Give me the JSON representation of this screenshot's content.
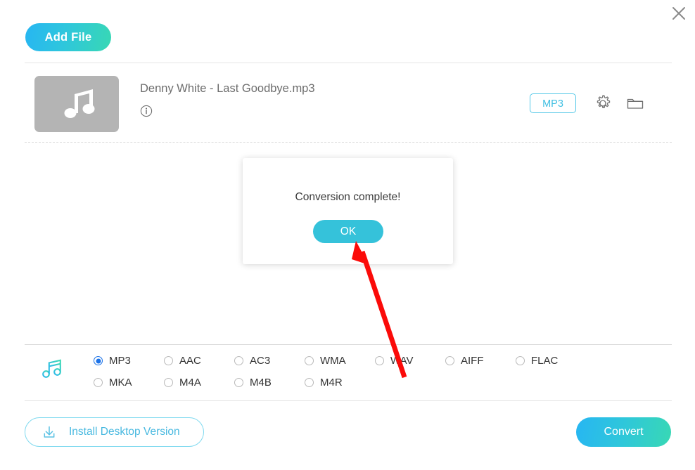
{
  "window": {
    "close_label": "×",
    "close_icon": "close-icon"
  },
  "toolbar": {
    "add_file_label": "Add File"
  },
  "file_row": {
    "thumbnail_icon": "music-note-icon",
    "file_name": "Denny White - Last Goodbye.mp3",
    "info_icon": "info-icon",
    "output_format_chip": "MP3",
    "settings_icon": "gear-icon",
    "folder_icon": "folder-icon"
  },
  "format_panel": {
    "panel_icon": "music-note-icon",
    "selected_format": "MP3",
    "row1": [
      {
        "label": "MP3",
        "selected": true
      },
      {
        "label": "AAC",
        "selected": false
      },
      {
        "label": "AC3",
        "selected": false
      },
      {
        "label": "WMA",
        "selected": false
      },
      {
        "label": "WAV",
        "selected": false
      },
      {
        "label": "AIFF",
        "selected": false
      },
      {
        "label": "FLAC",
        "selected": false
      }
    ],
    "row2": [
      {
        "label": "MKA",
        "selected": false
      },
      {
        "label": "M4A",
        "selected": false
      },
      {
        "label": "M4B",
        "selected": false
      },
      {
        "label": "M4R",
        "selected": false
      }
    ]
  },
  "footer": {
    "install_label": "Install Desktop Version",
    "install_icon": "download-icon",
    "convert_label": "Convert"
  },
  "modal": {
    "message": "Conversion complete!",
    "ok_label": "OK"
  },
  "annotation": {
    "arrow_icon": "red-arrow-pointer",
    "color": "#fb0b09"
  },
  "colors": {
    "accent_blue": "#27b6f2",
    "accent_teal": "#38d8b4",
    "modal_button": "#35c2da",
    "chip_border": "#55c8e8",
    "radio_selected": "#1b72e8",
    "thumb_bg": "#b4b4b4",
    "text_primary": "#333333",
    "text_muted": "#6d6d6d"
  }
}
